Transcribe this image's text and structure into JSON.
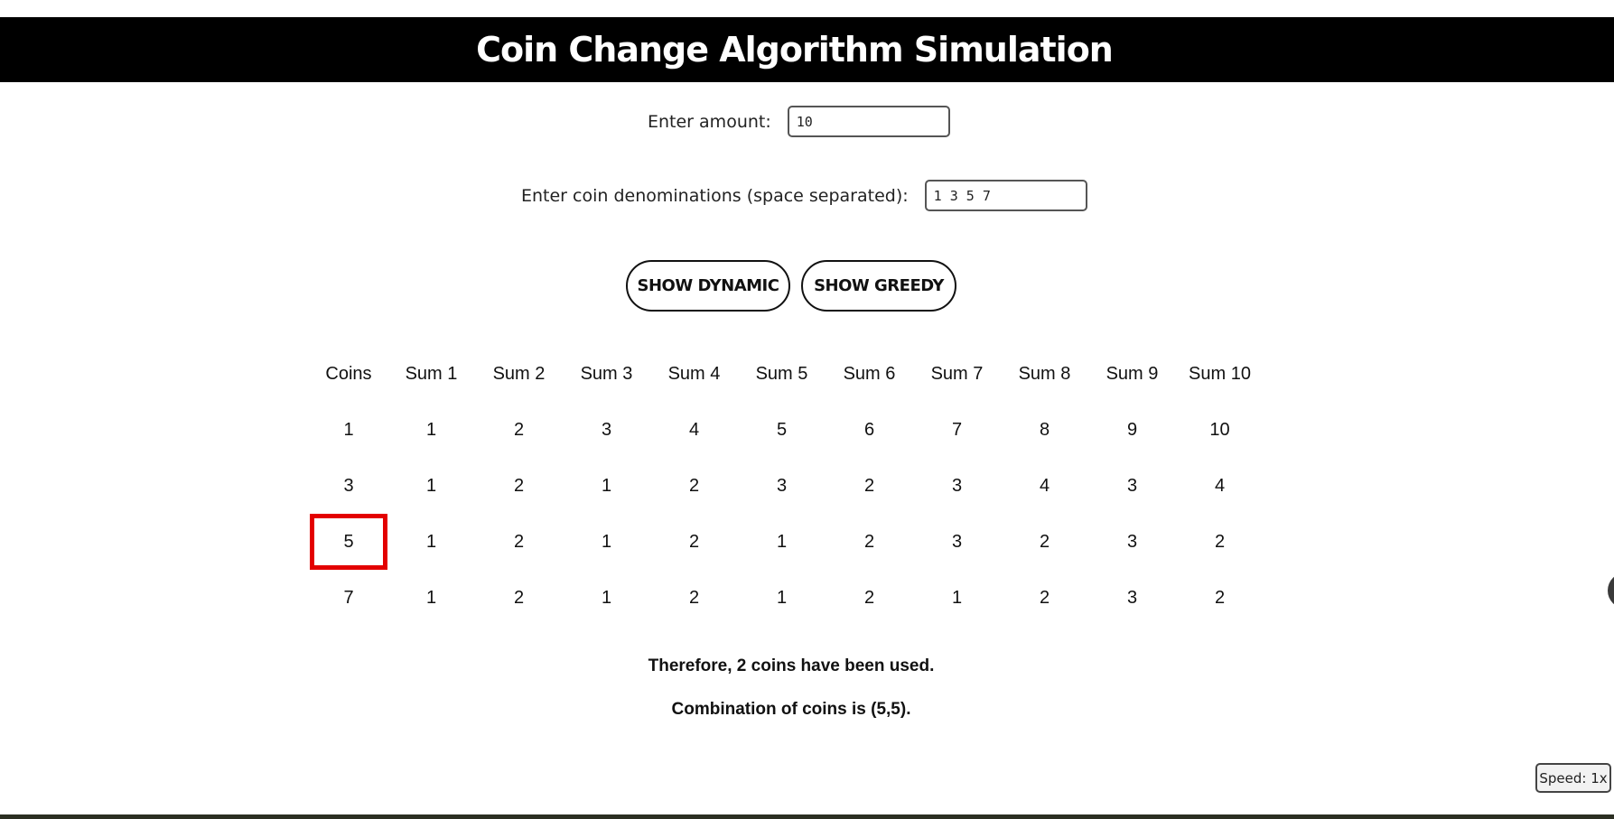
{
  "header": {
    "title": "Coin Change Algorithm Simulation"
  },
  "form": {
    "amount_label": "Enter amount:",
    "amount_value": "10",
    "coins_label": "Enter coin denominations (space separated):",
    "coins_value": "1 3 5 7"
  },
  "buttons": {
    "dynamic_label": "SHOW DYNAMIC",
    "greedy_label": "SHOW GREEDY"
  },
  "table": {
    "headers": [
      "Coins",
      "Sum 1",
      "Sum 2",
      "Sum 3",
      "Sum 4",
      "Sum 5",
      "Sum 6",
      "Sum 7",
      "Sum 8",
      "Sum 9",
      "Sum 10"
    ],
    "rows": [
      [
        "1",
        "1",
        "2",
        "3",
        "4",
        "5",
        "6",
        "7",
        "8",
        "9",
        "10"
      ],
      [
        "3",
        "1",
        "2",
        "1",
        "2",
        "3",
        "2",
        "3",
        "4",
        "3",
        "4"
      ],
      [
        "5",
        "1",
        "2",
        "1",
        "2",
        "1",
        "2",
        "3",
        "2",
        "3",
        "2"
      ],
      [
        "7",
        "1",
        "2",
        "1",
        "2",
        "1",
        "2",
        "1",
        "2",
        "3",
        "2"
      ]
    ],
    "highlight_color": "#e30000"
  },
  "result": {
    "coins_used": "Therefore, 2 coins have been used.",
    "combination": "Combination of coins is (5,5)."
  },
  "speed": {
    "label": "Speed: 1x"
  },
  "colors": {
    "header_bg": "#000000",
    "header_text": "#ffffff",
    "highlight": "#e30000"
  }
}
